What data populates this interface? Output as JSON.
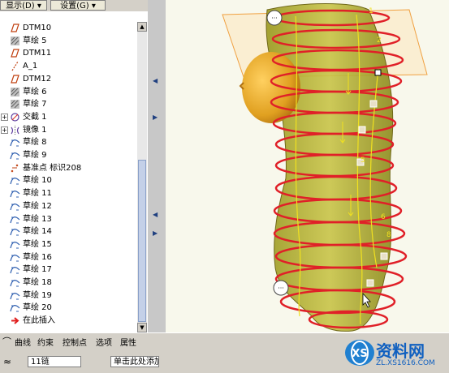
{
  "toolbar": {
    "show_label": "显示(D)",
    "settings_label": "设置(G)"
  },
  "tree": {
    "items": [
      {
        "label": "DTM10",
        "icon": "datum-plane-icon"
      },
      {
        "label": "草绘 5",
        "icon": "sketch-icon"
      },
      {
        "label": "DTM11",
        "icon": "datum-plane-icon"
      },
      {
        "label": "A_1",
        "icon": "datum-axis-icon"
      },
      {
        "label": "DTM12",
        "icon": "datum-plane-icon"
      },
      {
        "label": "草绘 6",
        "icon": "sketch-icon"
      },
      {
        "label": "草绘 7",
        "icon": "sketch-icon"
      },
      {
        "label": "交截 1",
        "icon": "intersect-icon",
        "expandable": true
      },
      {
        "label": "镜像 1",
        "icon": "mirror-icon",
        "expandable": true
      },
      {
        "label": "草绘 8",
        "icon": "sketch-curve-icon"
      },
      {
        "label": "草绘 9",
        "icon": "sketch-curve-icon"
      },
      {
        "label": "基准点 标识208",
        "icon": "datum-point-icon"
      },
      {
        "label": "草绘 10",
        "icon": "sketch-curve-icon"
      },
      {
        "label": "草绘 11",
        "icon": "sketch-curve-icon"
      },
      {
        "label": "草绘 12",
        "icon": "sketch-curve-icon"
      },
      {
        "label": "草绘 13",
        "icon": "sketch-curve-icon"
      },
      {
        "label": "草绘 14",
        "icon": "sketch-curve-icon"
      },
      {
        "label": "草绘 15",
        "icon": "sketch-curve-icon"
      },
      {
        "label": "草绘 16",
        "icon": "sketch-curve-icon"
      },
      {
        "label": "草绘 17",
        "icon": "sketch-curve-icon"
      },
      {
        "label": "草绘 18",
        "icon": "sketch-curve-icon"
      },
      {
        "label": "草绘 19",
        "icon": "sketch-curve-icon"
      },
      {
        "label": "草绘 20",
        "icon": "sketch-curve-icon"
      },
      {
        "label": "在此插入",
        "icon": "insert-here-arrow-icon"
      }
    ]
  },
  "viewport": {
    "number_labels": [
      "1",
      "2",
      "5",
      "6",
      "8"
    ]
  },
  "bottom": {
    "tabs": [
      "曲线",
      "约束",
      "控制点",
      "选项",
      "属性"
    ],
    "chain_value": "11链",
    "click_field": "单击此处添加"
  },
  "logo": {
    "line1": "资料网",
    "line2": "ZL.XS1616.COM"
  },
  "colors": {
    "curve_red": "#e02028",
    "surface_olive": "#b4b030",
    "plane_orange": "#f0a040",
    "dome_gold": "#e0a020"
  }
}
